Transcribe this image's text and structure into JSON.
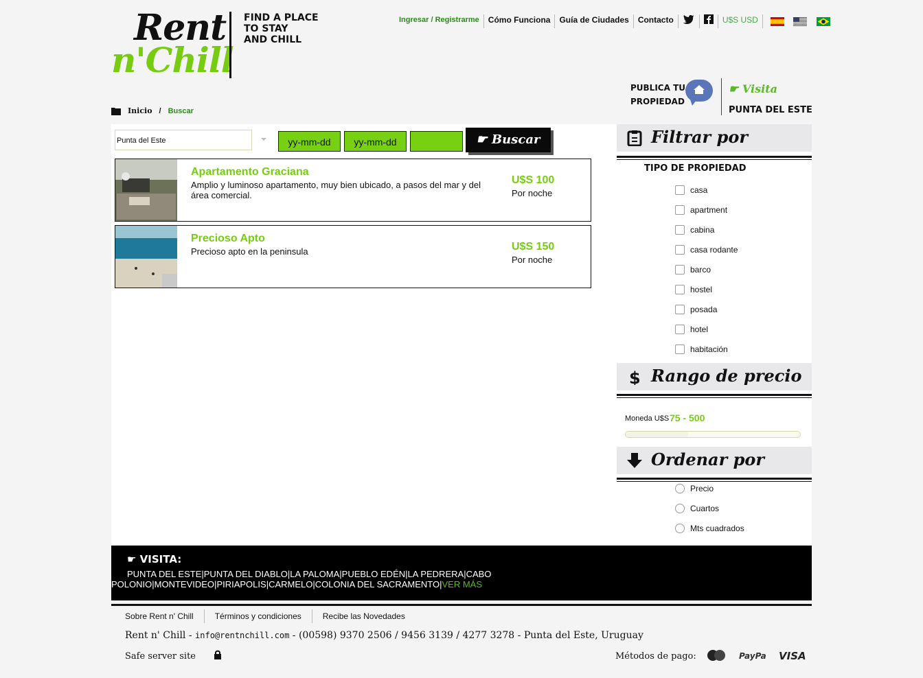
{
  "logo": {
    "line1": "Rent",
    "line2": "n'Chill",
    "tagline": [
      "FIND A PLACE",
      "TO STAY",
      "AND CHILL"
    ]
  },
  "topnav": {
    "login": "Ingresar / Registrarme",
    "como_funciona": "Cómo Funciona",
    "guia": "Guía de Ciudades",
    "contacto": "Contacto",
    "currency": "U$S USD",
    "flags": [
      "spain-flag",
      "usa-flag",
      "brazil-flag"
    ]
  },
  "breadcrumb": {
    "home": "Inicio",
    "separator": "/",
    "current": "Buscar"
  },
  "publica": {
    "line1": "PUBLICA TU",
    "line2": "PROPIEDAD"
  },
  "visita_promo": {
    "top": "Visita",
    "bottom": "PUNTA DEL ESTE"
  },
  "search": {
    "location_value": "Punta del Este",
    "checkin_placeholder": "yy-mm-dd",
    "checkout_placeholder": "yy-mm-dd",
    "guests_value": "",
    "button": "Buscar"
  },
  "listings": [
    {
      "title": "Apartamento Graciana",
      "desc": "Amplio y luminoso apartamento, muy bien ubicado, a pasos del mar y del área comercial.",
      "price": "U$S 100",
      "per": "Por noche"
    },
    {
      "title": "Precioso Apto",
      "desc": "Precioso apto en la peninsula",
      "price": "U$S 150",
      "per": "Por noche"
    }
  ],
  "filter": {
    "title": "Filtrar por",
    "tipo_title": "TIPO DE PROPIEDAD",
    "types": [
      "casa",
      "apartment",
      "cabina",
      "casa rodante",
      "barco",
      "hostel",
      "posada",
      "hotel",
      "habitación"
    ]
  },
  "price_range": {
    "title": "Rango de precio",
    "currency_label": "Moneda U$S",
    "value": "75 - 500",
    "fill_fraction": 0.36
  },
  "order": {
    "title": "Ordenar por",
    "options": [
      "Precio",
      "Cuartos",
      "Mts cuadrados"
    ]
  },
  "footer": {
    "visita_label": "VISITA:",
    "cities": [
      "PUNTA DEL ESTE",
      "PUNTA DEL DIABLO",
      "LA PALOMA",
      "PUEBLO EDÉN",
      "LA PEDRERA",
      "CABO POLONIO",
      "MONTEVIDEO",
      "PIRIAPOLIS",
      "CARMELO",
      "COLONIA DEL SACRAMENTO"
    ],
    "ver_mas": "VER MÁS",
    "links": [
      "Sobre Rent n' Chill",
      "Términos y condiciones",
      "Recibe las Novedades"
    ],
    "contact_prefix": "Rent n' Chill - ",
    "email": "info@rentnchill.com",
    "contact_suffix": " - (00598) 9370 2506 / 9456 3139 / 4277 3278 - Punta del Este, Uruguay",
    "safe": "Safe server site",
    "metodos": "Métodos de pago:",
    "payment_icons": [
      "mastercard-icon",
      "paypal-icon",
      "visa-icon"
    ]
  },
  "colors": {
    "accent_green": "#77cc11",
    "link_green": "#2a8c1a",
    "footer_bg": "#000000"
  }
}
